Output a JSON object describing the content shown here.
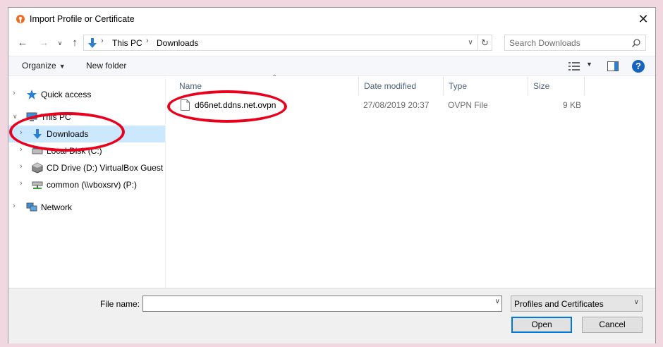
{
  "window": {
    "title": "Import Profile or Certificate",
    "close_label": "✕"
  },
  "address": {
    "crumbs": [
      "This PC",
      "Downloads"
    ],
    "search_placeholder": "Search Downloads"
  },
  "toolbar": {
    "organize_label": "Organize",
    "new_folder_label": "New folder",
    "help_label": "?"
  },
  "nav": {
    "items": [
      {
        "label": "Quick access",
        "icon": "star-icon"
      },
      {
        "label": "This PC",
        "icon": "computer-icon"
      },
      {
        "label": "Downloads",
        "icon": "download-arrow-icon",
        "selected": true
      },
      {
        "label": "Local Disk (C:)",
        "icon": "drive-icon"
      },
      {
        "label": "CD Drive (D:) VirtualBox Guest A",
        "icon": "cd-drive-icon"
      },
      {
        "label": "common (\\\\vboxsrv) (P:)",
        "icon": "network-drive-icon"
      },
      {
        "label": "Network",
        "icon": "network-icon"
      }
    ]
  },
  "files": {
    "columns": [
      "Name",
      "Date modified",
      "Type",
      "Size"
    ],
    "rows": [
      {
        "name": "d66net.ddns.net.ovpn",
        "date": "27/08/2019 20:37",
        "type": "OVPN File",
        "size": "9 KB"
      }
    ]
  },
  "footer": {
    "file_name_label": "File name:",
    "file_name_value": "",
    "filter_label": "Profiles and Certificates",
    "open_label": "Open",
    "cancel_label": "Cancel"
  },
  "colors": {
    "selection": "#cce8ff",
    "annotation": "#e8001c",
    "accent": "#0078d7"
  }
}
